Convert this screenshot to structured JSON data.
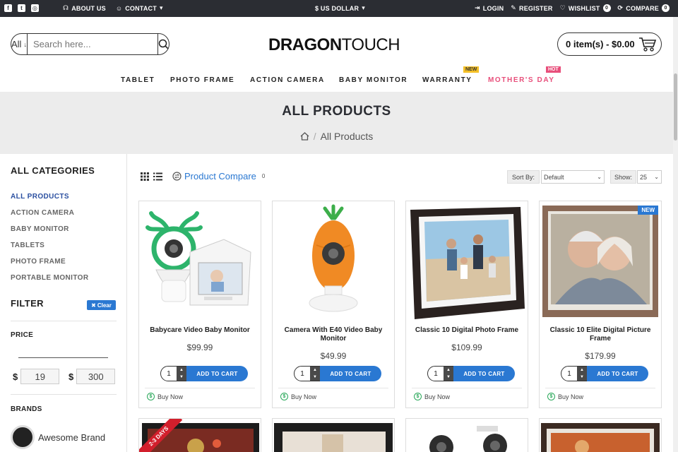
{
  "topbar": {
    "links": {
      "about": "ABOUT US",
      "contact": "CONTACT"
    },
    "currency": "$ US DOLLAR",
    "login": "LOGIN",
    "register": "REGISTER",
    "wishlist": "WISHLIST",
    "wishlist_count": "0",
    "compare": "COMPARE",
    "compare_count": "0"
  },
  "header": {
    "search_category": "All",
    "search_placeholder": "Search here...",
    "logo_bold": "DRAGON",
    "logo_light": "TOUCH",
    "cart": "0 item(s) - $0.00"
  },
  "nav": {
    "items": [
      "TABLET",
      "PHOTO FRAME",
      "ACTION CAMERA",
      "BABY MONITOR",
      "WARRANTY",
      "MOTHER'S DAY"
    ],
    "warranty_badge": "NEW",
    "mothers_badge": "HOT"
  },
  "banner": {
    "title": "ALL PRODUCTS",
    "crumb": "All Products"
  },
  "sidebar": {
    "title": "ALL CATEGORIES",
    "categories": [
      "ALL PRODUCTS",
      "ACTION CAMERA",
      "BABY MONITOR",
      "TABLETS",
      "PHOTO FRAME",
      "PORTABLE MONITOR"
    ],
    "filter_title": "FILTER",
    "clear_label": "Clear",
    "price_label": "PRICE",
    "currency_symbol": "$",
    "price_min": "19",
    "price_max": "300",
    "brands_label": "BRANDS",
    "brand_name": "Awesome Brand"
  },
  "toolbar": {
    "compare_label": "Product Compare",
    "compare_count": "0",
    "sort_label": "Sort By:",
    "sort_value": "Default",
    "show_label": "Show:",
    "show_value": "25"
  },
  "products": [
    {
      "name": "Babycare Video Baby Monitor",
      "price": "$99.99",
      "qty": "1",
      "add": "ADD TO CART",
      "buy": "Buy Now"
    },
    {
      "name": "Camera With E40 Video Baby Monitor",
      "price": "$49.99",
      "qty": "1",
      "add": "ADD TO CART",
      "buy": "Buy Now"
    },
    {
      "name": "Classic 10 Digital Photo Frame",
      "price": "$109.99",
      "qty": "1",
      "add": "ADD TO CART",
      "buy": "Buy Now"
    },
    {
      "name": "Classic 10 Elite Digital Picture Frame",
      "price": "$179.99",
      "qty": "1",
      "add": "ADD TO CART",
      "buy": "Buy Now",
      "badge": "NEW"
    }
  ],
  "row2": {
    "ribbon": "2-3 DAYS"
  }
}
